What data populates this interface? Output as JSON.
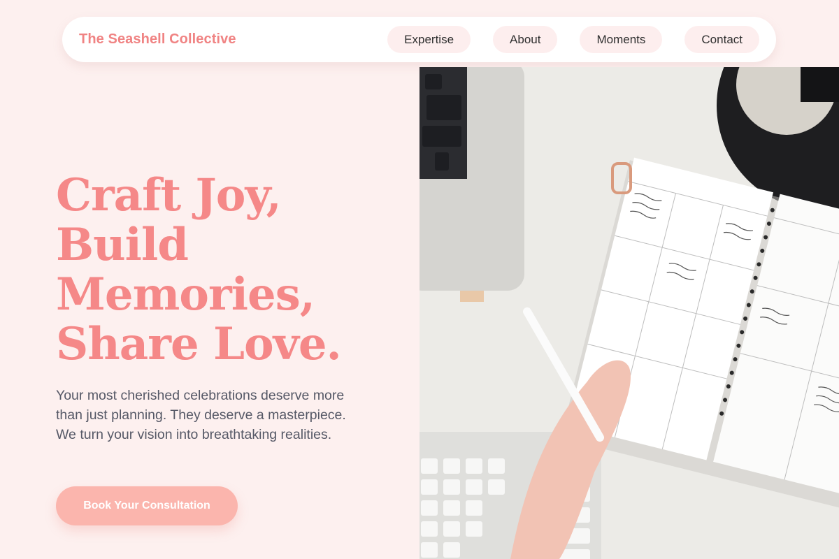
{
  "brand": "The Seashell Collective",
  "nav": {
    "items": [
      {
        "label": "Expertise"
      },
      {
        "label": "About"
      },
      {
        "label": "Moments"
      },
      {
        "label": "Contact"
      }
    ]
  },
  "hero": {
    "headline_lines": [
      "Craft Joy,",
      "Build",
      "Memories,",
      "Share Love."
    ],
    "subtext": "Your most cherished celebrations deserve more than just planning. They deserve a masterpiece. We turn your vision into breathtaking realities.",
    "cta_label": "Book Your Consultation"
  },
  "colors": {
    "background": "#fdf0ef",
    "accent": "#f58888",
    "cta": "#fbb5ad",
    "nav_pill": "#fdeeee"
  }
}
